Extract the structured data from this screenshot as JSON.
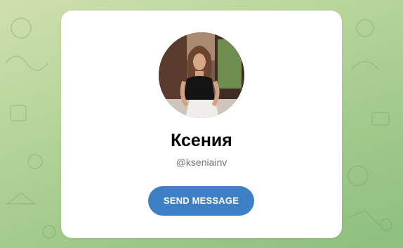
{
  "profile": {
    "name": "Ксения",
    "username": "@kseniainv",
    "avatar_alt": "profile-photo"
  },
  "actions": {
    "send_message_label": "SEND MESSAGE"
  },
  "colors": {
    "accent": "#3d80c6",
    "card_background": "#ffffff",
    "username_text": "#707579",
    "wallpaper": "#a9cf92"
  }
}
